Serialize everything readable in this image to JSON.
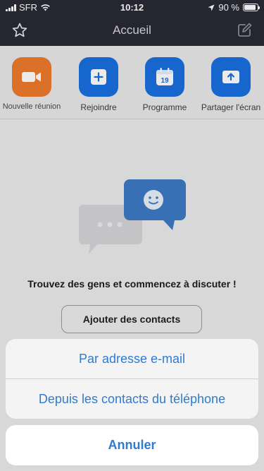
{
  "status_bar": {
    "carrier": "SFR",
    "time": "10:12",
    "battery": "90 %",
    "battery_level": 0.9
  },
  "nav": {
    "title": "Accueil",
    "left_icon": "star-icon",
    "right_icon": "compose-icon"
  },
  "actions": [
    {
      "label": "Nouvelle réunion",
      "icon": "video-camera-icon",
      "color": "#ee7a2d"
    },
    {
      "label": "Rejoindre",
      "icon": "plus-icon",
      "color": "#1a6fe0"
    },
    {
      "label": "Programme",
      "icon": "calendar-icon",
      "color": "#1a6fe0",
      "calendar_day": "19"
    },
    {
      "label": "Partager l'écran",
      "icon": "share-screen-icon",
      "color": "#1a6fe0"
    }
  ],
  "empty_state": {
    "message": "Trouvez des gens et commencez à discuter !",
    "button_label": "Ajouter des contacts"
  },
  "action_sheet": {
    "options": [
      "Par adresse e-mail",
      "Depuis les contacts du téléphone"
    ],
    "cancel_label": "Annuler",
    "accent": "#2f7bd0"
  }
}
